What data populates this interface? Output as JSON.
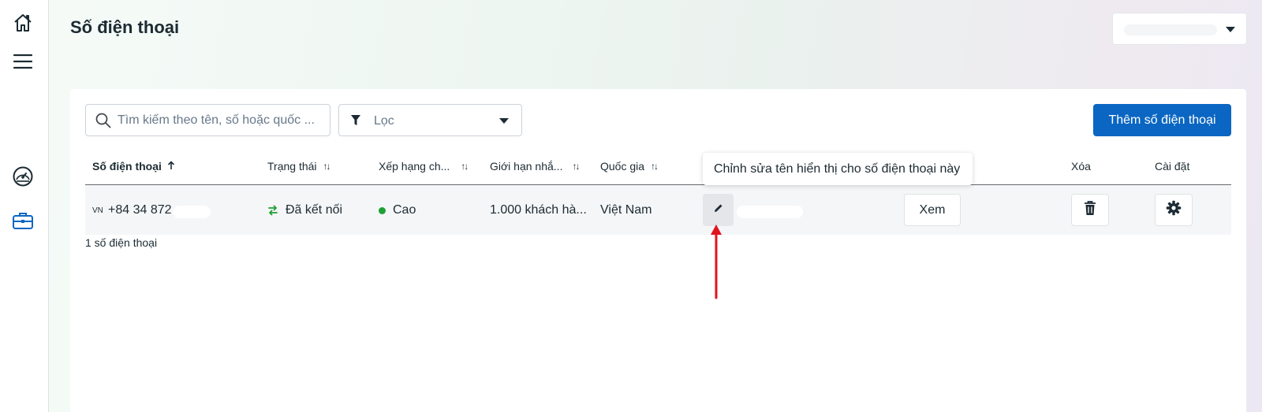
{
  "page": {
    "title": "Số điện thoại"
  },
  "sidebar": {
    "items": [
      {
        "icon": "home-icon"
      },
      {
        "icon": "menu-icon"
      },
      {
        "icon": "dashboard-icon"
      },
      {
        "icon": "briefcase-icon",
        "active": true
      }
    ]
  },
  "toolbar": {
    "search_placeholder": "Tìm kiếm theo tên, số hoặc quốc ...",
    "filter_label": "Lọc",
    "add_button_label": "Thêm số điện thoại"
  },
  "table": {
    "columns": [
      "Số điện thoại",
      "Trạng thái",
      "Xếp hạng ch...",
      "Giới hạn nhắ...",
      "Quốc gia",
      "Xóa",
      "Cài đặt"
    ],
    "rows": [
      {
        "country_code": "VN",
        "phone": "+84 34 872",
        "status": "Đã kết nối",
        "rating": "Cao",
        "limit": "1.000 khách hà...",
        "country": "Việt Nam",
        "view_label": "Xem"
      }
    ],
    "count_text": "1 số điện thoại"
  },
  "tooltip": {
    "text": "Chỉnh sửa tên hiển thị cho số điện thoại này"
  },
  "colors": {
    "primary": "#0a66c2",
    "status_connected": "#1ea035",
    "annotation_arrow": "#e0141e",
    "sidebar_active_icon": "#0a66c2"
  }
}
